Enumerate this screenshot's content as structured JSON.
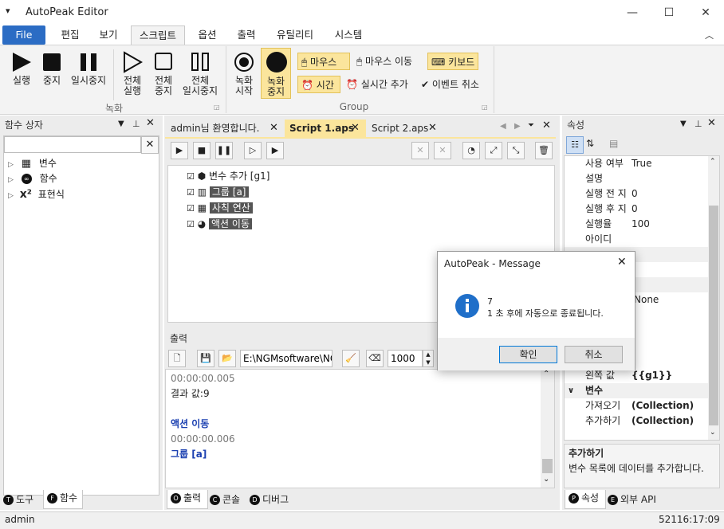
{
  "window": {
    "title": "AutoPeak Editor"
  },
  "menu": {
    "file": "File",
    "items": [
      "편집",
      "보기",
      "스크립트",
      "옵션",
      "출력",
      "유틸리티",
      "시스템"
    ]
  },
  "ribbon": {
    "record_group": {
      "label": "녹화",
      "run": "실행",
      "stop": "중지",
      "pause": "일시중지",
      "run_all_1": "전체",
      "run_all_2": "실행",
      "stop_all_1": "전체",
      "stop_all_2": "중지",
      "pause_all_1": "전체",
      "pause_all_2": "일시중지"
    },
    "group": {
      "label": "Group",
      "rec_start_1": "녹화",
      "rec_start_2": "시작",
      "rec_stop_1": "녹화",
      "rec_stop_2": "중지",
      "mouse": "마우스",
      "mouse_move": "마우스 이동",
      "keyboard": "키보드",
      "time": "시간",
      "realtime_add": "실시간 추가",
      "event_cancel": "이벤트 취소"
    }
  },
  "left_panel": {
    "title": "함수 상자",
    "search_value": "",
    "tree": [
      "변수",
      "함수",
      "표현식"
    ],
    "tabs": [
      "도구",
      "함수"
    ]
  },
  "doc_tabs": [
    "admin님 환영합니다.",
    "Script 1.aps",
    "Script 2.aps"
  ],
  "script_tree": [
    {
      "label": "변수 추가 [g1]",
      "icon": "cube-icon",
      "highlight": false
    },
    {
      "label": "그룹 [a]",
      "icon": "books-icon",
      "highlight": true
    },
    {
      "label": "사칙 연산",
      "icon": "calculator-icon",
      "highlight": true
    },
    {
      "label": "액션 이동",
      "icon": "pacman-icon",
      "highlight": true
    }
  ],
  "output": {
    "title": "출력",
    "path": "E:\\NGMsoftware\\NG",
    "spin_value": "1000",
    "lines": [
      {
        "text": "00:00:00.005",
        "kind": "time"
      },
      {
        "text": "결과 값:9",
        "kind": "normal"
      },
      {
        "text": "",
        "kind": "normal"
      },
      {
        "text": "액션 이동",
        "kind": "action"
      },
      {
        "text": "00:00:00.006",
        "kind": "time"
      },
      {
        "text": "그룹 [a]",
        "kind": "action"
      }
    ],
    "tabs": [
      "출력",
      "콘솔",
      "디버그"
    ]
  },
  "properties": {
    "title": "속성",
    "rows": [
      {
        "name": "사용 여부",
        "value": "True"
      },
      {
        "name": "설명",
        "value": ""
      },
      {
        "name": "실행 전 지",
        "value": "0"
      },
      {
        "name": "실행 후 지",
        "value": "0"
      },
      {
        "name": "실행율",
        "value": "100"
      },
      {
        "name": "아이디",
        "value": ""
      }
    ],
    "partial_value": "None",
    "left_value_name": "왼쪽 값",
    "left_value": "{{g1}}",
    "category": "변수",
    "rows2": [
      {
        "name": "가져오기",
        "value": "(Collection)"
      },
      {
        "name": "추가하기",
        "value": "(Collection)"
      }
    ],
    "desc_title": "추가하기",
    "desc_text": "변수 목록에 데이터를 추가합니다.",
    "tabs": [
      "속성",
      "외부 API"
    ]
  },
  "dialog": {
    "title": "AutoPeak - Message",
    "line1": "7",
    "line2": "1 초 후에 자동으로 종료됩니다.",
    "ok": "확인",
    "cancel": "취소"
  },
  "status": {
    "user": "admin",
    "right": "52116:17:09"
  },
  "colors": {
    "accent": "#2b6cc4",
    "highlight": "#fbe59c",
    "action_text": "#1a3fb0"
  }
}
